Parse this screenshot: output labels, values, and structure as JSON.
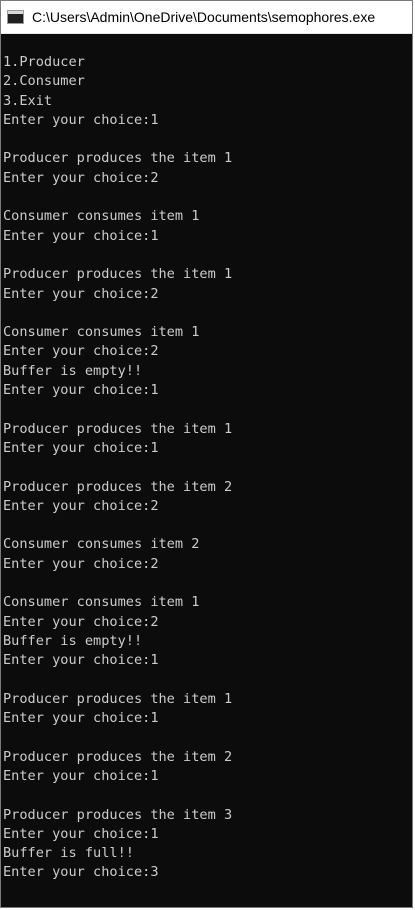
{
  "window": {
    "title": "C:\\Users\\Admin\\OneDrive\\Documents\\semophores.exe"
  },
  "console": {
    "lines": [
      "1.Producer",
      "2.Consumer",
      "3.Exit",
      "Enter your choice:1",
      "",
      "Producer produces the item 1",
      "Enter your choice:2",
      "",
      "Consumer consumes item 1",
      "Enter your choice:1",
      "",
      "Producer produces the item 1",
      "Enter your choice:2",
      "",
      "Consumer consumes item 1",
      "Enter your choice:2",
      "Buffer is empty!!",
      "Enter your choice:1",
      "",
      "Producer produces the item 1",
      "Enter your choice:1",
      "",
      "Producer produces the item 2",
      "Enter your choice:2",
      "",
      "Consumer consumes item 2",
      "Enter your choice:2",
      "",
      "Consumer consumes item 1",
      "Enter your choice:2",
      "Buffer is empty!!",
      "Enter your choice:1",
      "",
      "Producer produces the item 1",
      "Enter your choice:1",
      "",
      "Producer produces the item 2",
      "Enter your choice:1",
      "",
      "Producer produces the item 3",
      "Enter your choice:1",
      "Buffer is full!!",
      "Enter your choice:3"
    ]
  }
}
